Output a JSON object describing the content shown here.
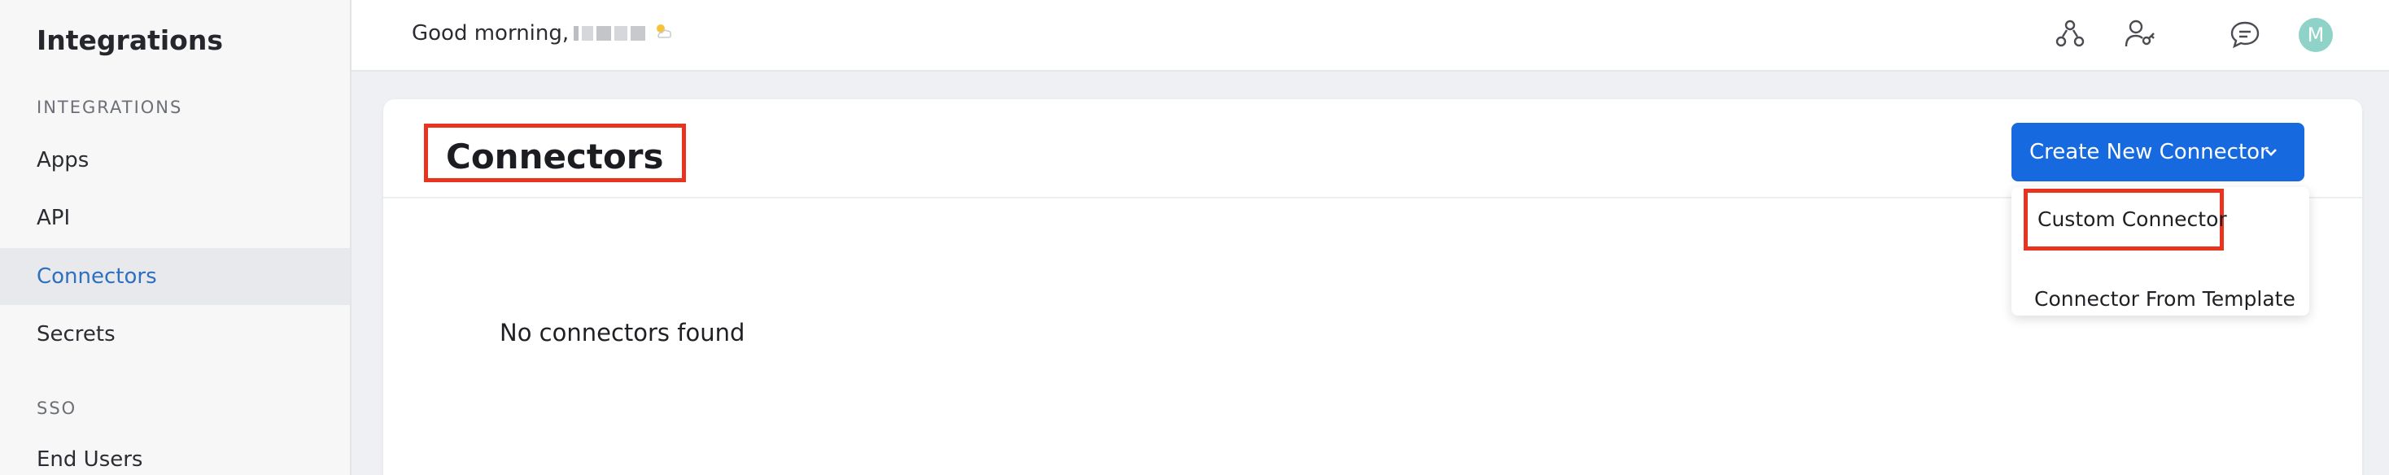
{
  "sidebar": {
    "title": "Integrations",
    "sections": [
      {
        "label": "INTEGRATIONS",
        "items": [
          "Apps",
          "API",
          "Connectors",
          "Secrets"
        ]
      },
      {
        "label": "SSO",
        "items": [
          "End Users"
        ]
      }
    ],
    "active_item": "Connectors"
  },
  "topbar": {
    "greeting": "Good morning,",
    "icons": [
      "users-network-icon",
      "user-key-icon",
      "chat-icon"
    ],
    "avatar_initial": "M",
    "avatar_color": "#8fd3c8"
  },
  "main": {
    "title": "Connectors",
    "empty_message": "No connectors found",
    "create_button": {
      "label": "Create New Connector",
      "color": "#1769e0"
    },
    "dropdown": {
      "items": [
        "Custom Connector",
        "Connector From Template"
      ]
    }
  },
  "colors": {
    "highlight_border": "#e8331e",
    "active_nav_text": "#2f6fbf"
  }
}
